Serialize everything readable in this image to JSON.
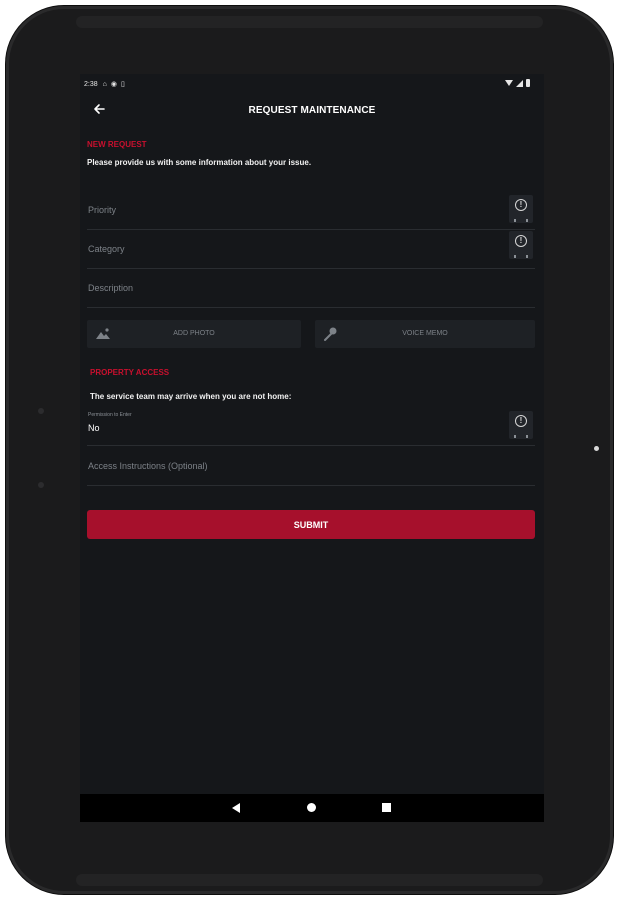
{
  "status_bar": {
    "time": "2:38",
    "icons": [
      "notification-icon",
      "android-icon",
      "sim-icon"
    ]
  },
  "app_bar": {
    "title": "REQUEST MAINTENANCE"
  },
  "new_request": {
    "section_label": "NEW REQUEST",
    "helper": "Please provide us with some information about your issue.",
    "priority_placeholder": "Priority",
    "category_placeholder": "Category",
    "description_placeholder": "Description"
  },
  "media": {
    "add_photo_label": "ADD PHOTO",
    "voice_memo_label": "VOICE MEMO"
  },
  "property_access": {
    "section_label": "PROPERTY ACCESS",
    "helper": "The service team may arrive when you are not home:",
    "permission_label": "Permission to Enter",
    "permission_value": "No",
    "instructions_placeholder": "Access Instructions (Optional)"
  },
  "actions": {
    "submit_label": "SUBMIT"
  },
  "colors": {
    "accent": "#c8102e",
    "submit": "#a6102c",
    "background": "#15171a"
  }
}
